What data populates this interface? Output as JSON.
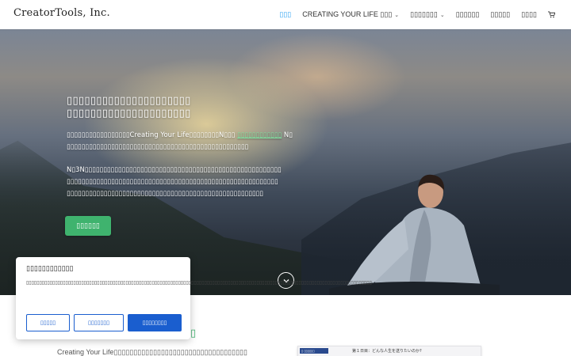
{
  "header": {
    "logo": "CreatorTools, Inc.",
    "nav": [
      {
        "label": "▯▯▯",
        "dropdown": false,
        "active": true
      },
      {
        "label": "CREATING YOUR LIFE ▯▯▯",
        "dropdown": true,
        "active": false
      },
      {
        "label": "▯▯▯▯▯▯▯",
        "dropdown": true,
        "active": false
      },
      {
        "label": "▯▯▯▯▯▯",
        "dropdown": false,
        "active": false
      },
      {
        "label": "▯▯▯▯▯",
        "dropdown": false,
        "active": false
      },
      {
        "label": "▯▯▯▯",
        "dropdown": false,
        "active": false
      }
    ],
    "cart_icon": "shopping-cart-icon"
  },
  "hero": {
    "title_line1": "▯▯▯▯▯▯▯▯▯▯▯▯▯▯▯▯▯▯▯▯▯",
    "title_line2": "▯▯▯▯▯▯▯▯▯▯▯▯▯▯▯▯▯▯▯▯▯",
    "para1_prefix": "▯▯▯▯▯▯▯▯▯▯▯▯▯▯▯▯▯Creating Your Life▯▯▯▯▯▯▯▯N▯▯▯ ",
    "para1_link": "▯▯▯▯▯▯▯▯▯▯▯▯",
    "para1_suffix": " N▯",
    "para1_line2": "▯▯▯▯▯▯▯▯▯▯▯▯▯▯▯▯▯▯▯▯▯▯▯▯▯▯▯▯▯▯▯▯▯▯▯▯▯▯▯▯▯▯▯▯▯▯▯▯▯",
    "para2_line1": "N▯3N▯▯▯▯▯▯▯▯▯▯▯▯▯▯▯▯▯▯▯▯▯▯▯▯▯▯▯▯▯▯▯▯▯▯▯▯▯▯▯▯▯▯▯▯▯▯▯▯▯▯▯▯▯",
    "para2_line2": "▯▯▯▯▯▯▯▯▯▯▯▯▯▯▯▯▯▯▯▯▯▯▯▯▯▯▯▯▯▯▯▯▯▯▯▯▯▯▯▯▯▯▯▯▯▯▯▯▯▯▯▯▯▯▯▯▯",
    "para2_line3": "▯▯▯▯▯▯▯▯▯▯▯▯▯▯▯▯▯▯▯▯▯▯▯▯▯▯▯▯▯▯▯▯▯▯▯▯▯▯▯▯▯▯▯▯▯▯▯▯▯▯▯▯▯",
    "cta_label": "▯▯▯▯▯▯",
    "link_color": "#7fe0a0",
    "cta_color": "#3fb36e"
  },
  "section": {
    "intro_text": "Creating Your Life▯▯▯▯▯▯▯▯▯▯▯▯▯▯▯▯▯▯▯▯▯▯▯▯▯▯▯▯▯▯▯▯▯▯",
    "mark": "▯",
    "preview_tag": "▯ ▯▯▯▯▯▯",
    "preview_title": "第１日目：どんな人生を送りたいのか?"
  },
  "cookie": {
    "title": "▯▯▯▯▯▯▯▯▯▯▯▯",
    "body": "▯▯▯▯▯▯▯▯▯▯▯▯▯▯▯▯▯▯▯▯▯▯▯▯▯▯▯▯▯▯▯▯▯▯▯▯▯▯▯▯▯▯▯▯▯▯▯▯▯▯▯▯▯▯▯▯▯▯▯▯▯▯▯▯▯▯▯▯▯▯▯▯▯▯▯▯▯▯▯▯▯▯▯▯▯▯▯▯▯▯▯▯▯▯▯▯▯▯▯▯▯▯▯▯▯▯▯▯▯▯▯▯▯▯▯▯▯▯▯▯▯▯▯▯▯▯▯▯▯▯▯▯",
    "btn_reject": "▯▯▯▯▯",
    "btn_customize": "▯▯▯▯▯▯▯",
    "btn_accept": "▯▯▯▯▯▯▯▯",
    "accent_color": "#1a5ecf"
  }
}
